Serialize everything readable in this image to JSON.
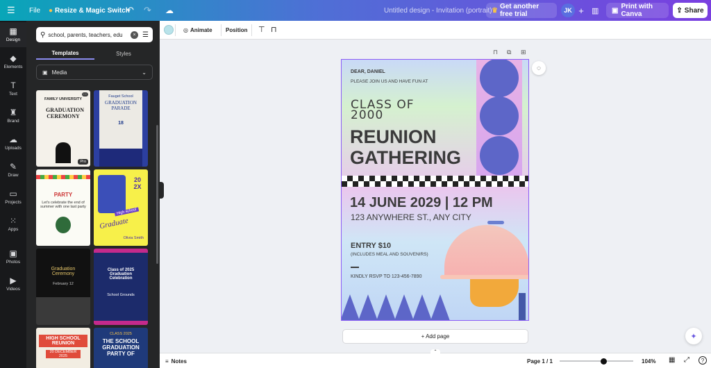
{
  "topbar": {
    "menu_icon": "menu-icon",
    "file": "File",
    "resize": "Resize & Magic Switch",
    "doc_title": "Untitled design - Invitation (portrait)",
    "trial": "Get another free trial",
    "avatar": "JK",
    "print": "Print with Canva",
    "share": "Share"
  },
  "leftnav": {
    "items": [
      {
        "label": "Design",
        "icon": "design-icon"
      },
      {
        "label": "Elements",
        "icon": "elements-icon"
      },
      {
        "label": "Text",
        "icon": "text-icon"
      },
      {
        "label": "Brand",
        "icon": "brand-icon"
      },
      {
        "label": "Uploads",
        "icon": "uploads-icon"
      },
      {
        "label": "Draw",
        "icon": "draw-icon"
      },
      {
        "label": "Projects",
        "icon": "projects-icon"
      },
      {
        "label": "Apps",
        "icon": "apps-icon"
      },
      {
        "label": "Photos",
        "icon": "photos-icon"
      },
      {
        "label": "Videos",
        "icon": "videos-icon"
      }
    ]
  },
  "panel": {
    "search_value": "school, parents, teachers, edu",
    "tabs": [
      "Templates",
      "Styles"
    ],
    "media": "Media",
    "templates": [
      {
        "title": "GRADUATION CEREMONY",
        "sub": "FAMILY UNIVERSITY",
        "badge": "Pro"
      },
      {
        "title": "GRADUATION PARADE",
        "sub": "Fauget School",
        "number": "18"
      },
      {
        "title": "PARTY",
        "sub": "Let's celebrate the end of summer with one last party"
      },
      {
        "title": "Graduate",
        "sub": "High school",
        "digits": "20 2X",
        "name": "Olivia Smith"
      },
      {
        "title": "Graduation Ceremony",
        "sub": "February 12"
      },
      {
        "title": "Class of 2025 Graduation Celebration",
        "sub": "School Grounds"
      },
      {
        "title": "HIGH SCHOOL REUNION",
        "sub": "20 DECEMBER 2025"
      },
      {
        "title": "THE SCHOOL GRADUATION PARTY OF",
        "sub": "CLASS 2025"
      }
    ]
  },
  "toolbar": {
    "color": "#b9e3ea",
    "animate": "Animate",
    "position": "Position"
  },
  "design": {
    "greeting": "DEAR, DANIEL",
    "invite": "PLEASE JOIN US AND HAVE FUN AT",
    "class": "CLASS OF 2000",
    "line1": "REUNION",
    "line2": "GATHERING",
    "date": "14 JUNE 2029 | 12 PM",
    "address": "123 ANYWHERE ST., ANY CITY",
    "entry": "ENTRY $10",
    "includes": "(INCLUDES MEAL AND SOUVENIRS)",
    "rsvp": "KINDLY RSVP TO 123-456-7890"
  },
  "add_page": "+ Add page",
  "bottombar": {
    "notes": "Notes",
    "page": "Page 1 / 1",
    "zoom": "104%",
    "zoom_level": 0.6
  }
}
